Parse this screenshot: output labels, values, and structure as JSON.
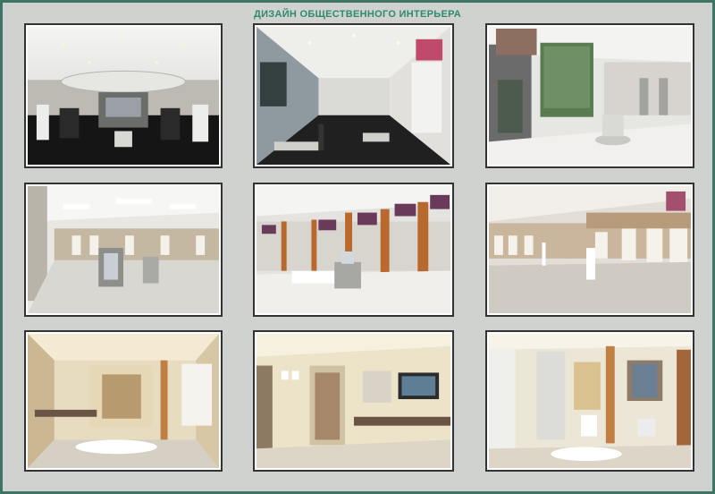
{
  "poster": {
    "title": "ДИЗАЙН ОБЩЕСТВЕННОГО ИНТЕРЬЕРА",
    "footer_note": "",
    "colors": {
      "frame": "#3e7566",
      "title": "#2f8a6f",
      "background": "#cfd2cf"
    },
    "panels": [
      {
        "id": "panel-1",
        "subject": "dark-floor-shop-hall"
      },
      {
        "id": "panel-2",
        "subject": "long-shop-corridor"
      },
      {
        "id": "panel-3",
        "subject": "shop-with-window"
      },
      {
        "id": "panel-4",
        "subject": "light-showroom"
      },
      {
        "id": "panel-5",
        "subject": "wood-column-showroom"
      },
      {
        "id": "panel-6",
        "subject": "mannequin-showroom"
      },
      {
        "id": "panel-7",
        "subject": "salon-corridor"
      },
      {
        "id": "panel-8",
        "subject": "salon-tv-room"
      },
      {
        "id": "panel-9",
        "subject": "salon-chair-room"
      }
    ]
  }
}
